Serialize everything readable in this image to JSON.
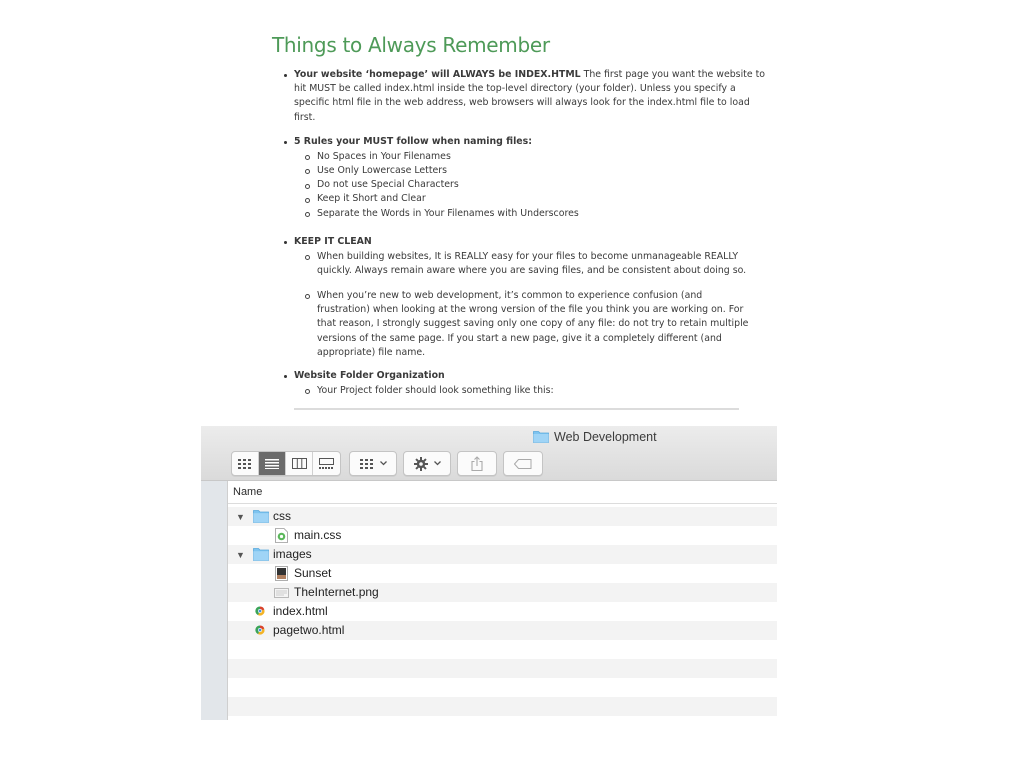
{
  "document": {
    "title": "Things to Always Remember",
    "homepage": {
      "bold": "Your website ‘homepage’ will ALWAYS be INDEX.HTML",
      "line1": " The first page you want the website to",
      "line2": "hit MUST be called index.html inside the top-level directory (your folder). Unless you specify a",
      "line3": "specific html file in the web address, web browsers will always look for the index.html file to load",
      "line4": "first."
    },
    "rules": {
      "heading": "5 Rules your MUST follow when naming files:",
      "items": [
        "No Spaces in Your Filenames",
        "Use Only Lowercase Letters",
        "Do not use Special Characters",
        "Keep it Short and Clear",
        "Separate the Words in Your Filenames with Underscores"
      ]
    },
    "clean": {
      "heading": "KEEP IT CLEAN",
      "p1": [
        "When building websites, It is REALLY easy for your files to become unmanageable REALLY",
        "quickly. Always remain aware where you are saving files, and be consistent about doing so."
      ],
      "p2": [
        "When you’re new to web development, it’s common to experience confusion (and",
        "frustration) when looking at the wrong version of the file you think you are working on. For",
        "that reason, I strongly suggest saving only one copy of any file: do not try to retain multiple",
        "versions of the same page. If you start a new page, give it a completely different (and",
        "appropriate) file name."
      ]
    },
    "folder": {
      "heading": "Website Folder Organization",
      "item": "Your Project folder should look something like this:"
    }
  },
  "finder": {
    "window_title": "Web Development",
    "column_header": "Name",
    "rows": [
      {
        "name": "css",
        "kind": "folder",
        "expanded": true,
        "depth": 0
      },
      {
        "name": "main.css",
        "kind": "css-file",
        "depth": 1
      },
      {
        "name": "images",
        "kind": "folder",
        "expanded": true,
        "depth": 0
      },
      {
        "name": "Sunset",
        "kind": "image-file",
        "depth": 1
      },
      {
        "name": "TheInternet.png",
        "kind": "png-file",
        "depth": 1
      },
      {
        "name": "index.html",
        "kind": "html-file",
        "depth": 0
      },
      {
        "name": "pagetwo.html",
        "kind": "html-file",
        "depth": 0
      }
    ],
    "colors": {
      "folder": "#7ec4f0",
      "title_green": "#4e9a58",
      "active_segment": "#6b6b6b"
    }
  }
}
